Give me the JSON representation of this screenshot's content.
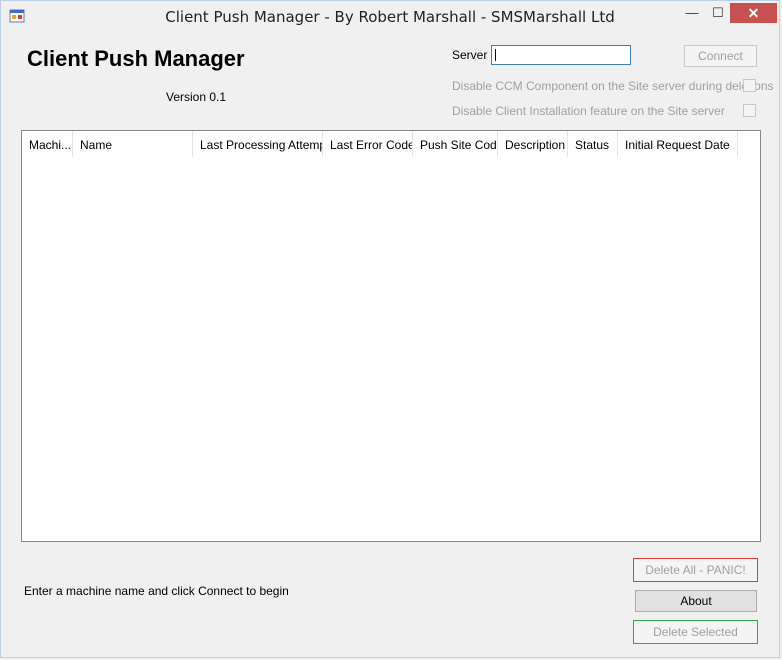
{
  "window": {
    "title": "Client Push Manager - By Robert Marshall - SMSMarshall Ltd",
    "icon": "app-window-icon",
    "minimize_glyph": "—",
    "maximize_glyph": "☐",
    "close_glyph": "✕",
    "close_color": "#c75050"
  },
  "header": {
    "title": "Client Push Manager",
    "version": "Version 0.1"
  },
  "server": {
    "label": "Server",
    "value": "",
    "connect_label": "Connect"
  },
  "options": [
    {
      "label": "Disable CCM Component on the Site server during deletions",
      "checked": false
    },
    {
      "label": "Disable Client Installation feature on the Site server",
      "checked": false
    }
  ],
  "table": {
    "columns": [
      "Machi...",
      "Name",
      "Last Processing Attempt",
      "Last Error Code",
      "Push Site Code",
      "Description",
      "Status",
      "Initial Request Date"
    ],
    "rows": []
  },
  "status": {
    "message": "Enter a machine name and click Connect to begin"
  },
  "actions": {
    "delete_all_label": "Delete All - PANIC!",
    "about_label": "About",
    "delete_selected_label": "Delete Selected",
    "delete_all_border": "#e03c3c",
    "delete_selected_border": "#2fa84f"
  }
}
